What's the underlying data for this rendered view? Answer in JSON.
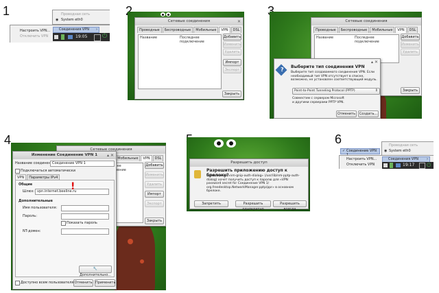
{
  "step_numbers": [
    "1",
    "2",
    "3",
    "4",
    "5",
    "6"
  ],
  "tray_menu_1": {
    "header": "Проводная сеть",
    "system_eth0": "System eth0",
    "vpn_connections": "Соединения VPN",
    "configure_vpn": "Настроить VPN...",
    "disconnect_vpn": "Отключить VPN",
    "clock": "19:05"
  },
  "network_connections": {
    "title": "Сетевые соединения",
    "tabs": [
      "Проводные",
      "Беспроводные",
      "Мобильные",
      "VPN",
      "DSL"
    ],
    "col_name": "Название",
    "col_last_used": "Последнее подключение",
    "add": "Добавить",
    "edit": "Изменить",
    "delete": "Удалить",
    "import": "Импорт",
    "export": "Экспорт",
    "close": "Закрыть"
  },
  "choose_vpn_type": {
    "heading": "Выберите тип соединения VPN",
    "description": "Выберите тип создаваемого соединения VPN. Если необходимый тип VPN отсутствует в списке, возможно, не установлен соответствующий модуль.",
    "option": "Point-to-Point Tunneling Protocol (PPTP)",
    "compat": "Совместим с сервером Microsoft и другими серверами PPTP VPN.",
    "cancel": "Отменить",
    "create": "Создать..."
  },
  "edit_vpn": {
    "title": "Изменение Соединение VPN 1",
    "conn_name_label": "Название соединения:",
    "conn_name_value": "Соединение VPN 1",
    "autoconnect": "Подключаться автоматически",
    "tab_vpn": "VPN",
    "tab_ipv4": "Параметры IPv4",
    "general": "Общие",
    "gateway_label": "Шлюз:",
    "gateway_value": "vpn.internet.beeline.ru",
    "warning_mark": "!",
    "optional": "Дополнительные",
    "username": "Имя пользователя:",
    "password": "Пароль:",
    "show_password": "Показать пароль",
    "nt_domain": "NT-домен:",
    "advanced": "Дополнительно...",
    "all_users": "Доступно всем пользователям",
    "cancel": "Отменить",
    "apply": "Применить"
  },
  "keyring_access": {
    "title": "Разрешить доступ",
    "heading": "Разрешить приложению доступ к брелоку?",
    "description": "Приложение «nm-gnip-auth-dialog» (/usr/lib/nm-pptp-auth-dialog) хочет получить доступ к паролю для «VPN password secret for Соединение VPN 1/ org.freedesktop.NetworkManager.pptp/ppr» в основном брелоке.",
    "deny": "Запретить",
    "allow_once": "Разрешить однократно",
    "allow_always": "Разрешить всегда"
  },
  "tray_menu_6": {
    "header": "Проводная сеть",
    "vpn_conn_1": "Соединение VPN 1",
    "system_eth0": "System eth0",
    "vpn_connections": "Соединения VPN",
    "configure_vpn": "Настроить VPN...",
    "disconnect_vpn": "Отключить VPN",
    "clock": "19:17"
  }
}
